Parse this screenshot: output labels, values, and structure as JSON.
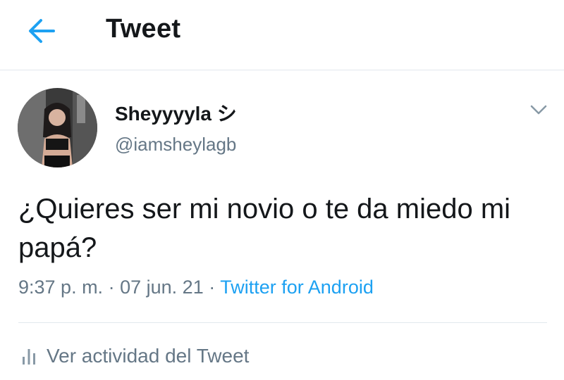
{
  "header": {
    "back_icon": "arrow-left-icon",
    "title": "Tweet",
    "accent_color": "#1da1f2"
  },
  "tweet": {
    "author": {
      "display_name": "Sheyyyyla シ",
      "handle": "@iamsheylagb",
      "avatar_icon": "profile-photo"
    },
    "menu_icon": "chevron-down-icon",
    "text": "¿Quieres ser mi novio o te da miedo mi papá?",
    "time": "9:37 p. m.",
    "separator": "·",
    "date": "07 jun. 21",
    "source": "Twitter for Android",
    "activity": {
      "icon": "bar-chart-icon",
      "label": "Ver actividad del Tweet"
    }
  },
  "colors": {
    "primary_text": "#14171a",
    "secondary_text": "#657786",
    "link": "#1da1f2",
    "divider": "#e1e8ed"
  }
}
